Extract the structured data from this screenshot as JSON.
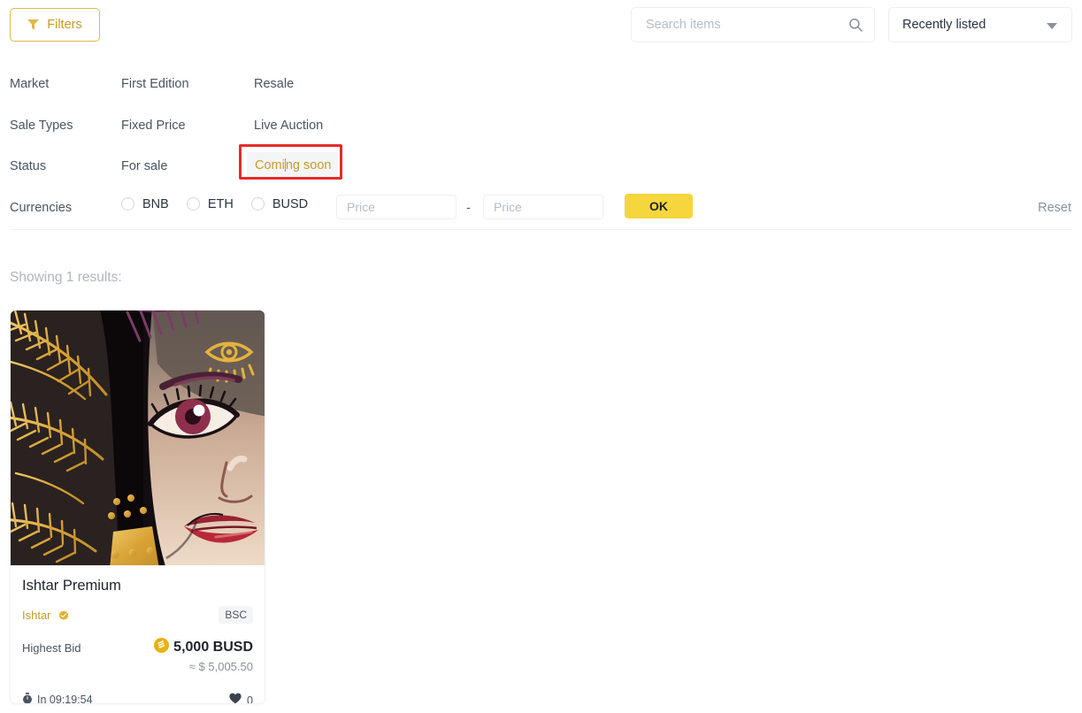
{
  "toolbar": {
    "filters_label": "Filters",
    "filters_icon": "funnel-icon",
    "search_placeholder": "Search items",
    "search_value": "",
    "search_icon": "search-icon",
    "sort_selected": "Recently listed",
    "sort_icon": "chevron-down-icon"
  },
  "filters": {
    "rows": [
      {
        "label": "Market",
        "options": [
          "First Edition",
          "Resale"
        ]
      },
      {
        "label": "Sale Types",
        "options": [
          "Fixed Price",
          "Live Auction"
        ]
      },
      {
        "label": "Status",
        "options": [
          "For sale",
          "Coming soon"
        ],
        "selected": "Coming soon"
      }
    ],
    "currencies_label": "Currencies",
    "currencies": [
      {
        "label": "BNB",
        "checked": false
      },
      {
        "label": "ETH",
        "checked": false
      },
      {
        "label": "BUSD",
        "checked": false
      }
    ],
    "price_min_placeholder": "Price",
    "price_min_value": "",
    "price_max_placeholder": "Price",
    "price_max_value": "",
    "range_separator": "-",
    "ok_label": "OK",
    "reset_label": "Reset"
  },
  "results": {
    "showing_text": "Showing 1 results:",
    "cards": [
      {
        "title": "Ishtar Premium",
        "creator": "Ishtar",
        "creator_verified_icon": "verified-badge-icon",
        "chain": "BSC",
        "bid_label": "Highest Bid",
        "bid_currency_icon": "busd-coin-icon",
        "bid_amount": "5,000 BUSD",
        "bid_usd_equivalent": "≈ $ 5,005.50",
        "timer_icon": "stopwatch-icon",
        "timer_text": "In 09:19:54",
        "like_icon": "heart-icon",
        "like_count": "0"
      }
    ]
  },
  "annotation": {
    "type": "red-highlight-box",
    "target": "Coming soon",
    "color": "#E52B28"
  },
  "colors": {
    "accent_gold": "#C69B2E",
    "button_yellow": "#F5D63C",
    "annotation_red": "#E52B28"
  }
}
